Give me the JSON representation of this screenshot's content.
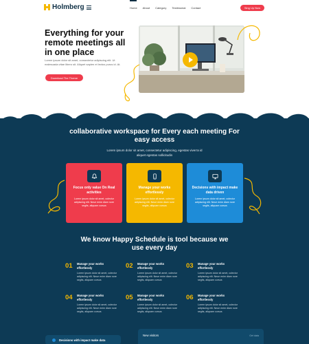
{
  "header": {
    "brand": "Holmberg",
    "nav": [
      "Home",
      "About",
      "Category",
      "Testimonial",
      "Contact"
    ],
    "signup_label": "Sing Up Now"
  },
  "hero": {
    "title": "Everything for your remote meetings all in one place",
    "text": "Lorem ipsum dolor sit amet, consectetur adipiscing elit. Ut malesuada vitae libero sit. Aliquet sapien et lectus purus id. At.",
    "button_label": "Download The Theme"
  },
  "workspace": {
    "title": "collaborative workspace for Every each meeting For easy access",
    "subtitle": "Lorem ipsum dolor sit amet, consectetur adipiscing, egestas viverra id aliquet egestas sollicitudin",
    "cards": [
      {
        "icon": "bell-icon",
        "title": "Focus only value On Real activities",
        "text": "Lorem ipsum dolor sit amet, colectur adipiscing elit. Neue enim diam nore segits, aliquam cursus"
      },
      {
        "icon": "mobile-icon",
        "title": "Manage your works effortlessly",
        "text": "Lorem ipsum dolor sit amet, colectur adipiscing elit. Neue enim diam nore segits, aliquam cursus"
      },
      {
        "icon": "monitor-icon",
        "title": "Decisions with impact make data driven",
        "text": "Lorem ipsum dolor sit amet, colectur adipiscing elit. Neue enim diam nore segits, aliquam cursus"
      }
    ]
  },
  "schedule": {
    "title": "We know Happy Schedule is tool because we use every day",
    "features": [
      {
        "num": "01",
        "title": "Manage your works effortlessly",
        "text": "Lorem ipsum dolor sit amet, colectur adipiscing elit. Neue enim diam nore segits, aliquam cursus"
      },
      {
        "num": "02",
        "title": "Manage your works effortlessly",
        "text": "Lorem ipsum dolor sit amet, colectur adipiscing elit. Neue enim diam nore segits, aliquam cursus"
      },
      {
        "num": "03",
        "title": "Manage your works effortlessly",
        "text": "Lorem ipsum dolor sit amet, colectur adipiscing elit. Neue enim diam nore segits, aliquam cursus"
      },
      {
        "num": "04",
        "title": "Manage your works effortlessly",
        "text": "Lorem ipsum dolor sit amet, colectur adipiscing elit. Neue enim diam nore segits, aliquam cursus"
      },
      {
        "num": "05",
        "title": "Manage your works effortlessly",
        "text": "Lorem ipsum dolor sit amet, colectur adipiscing elit. Neue enim diam nore segits, aliquam cursus"
      },
      {
        "num": "06",
        "title": "Manage your works effortlessly",
        "text": "Lorem ipsum dolor sit amet, colectur adipiscing elit. Neue enim diam nore segits, aliquam cursus"
      }
    ]
  },
  "bottom": {
    "pill_label": "Decisions with impact make data",
    "visitors_title": "New visitors",
    "visitors_link": "Get data"
  },
  "colors": {
    "navy": "#0d3a55",
    "red": "#ef3c4c",
    "yellow": "#f5b800",
    "blue": "#1e8cd8"
  }
}
